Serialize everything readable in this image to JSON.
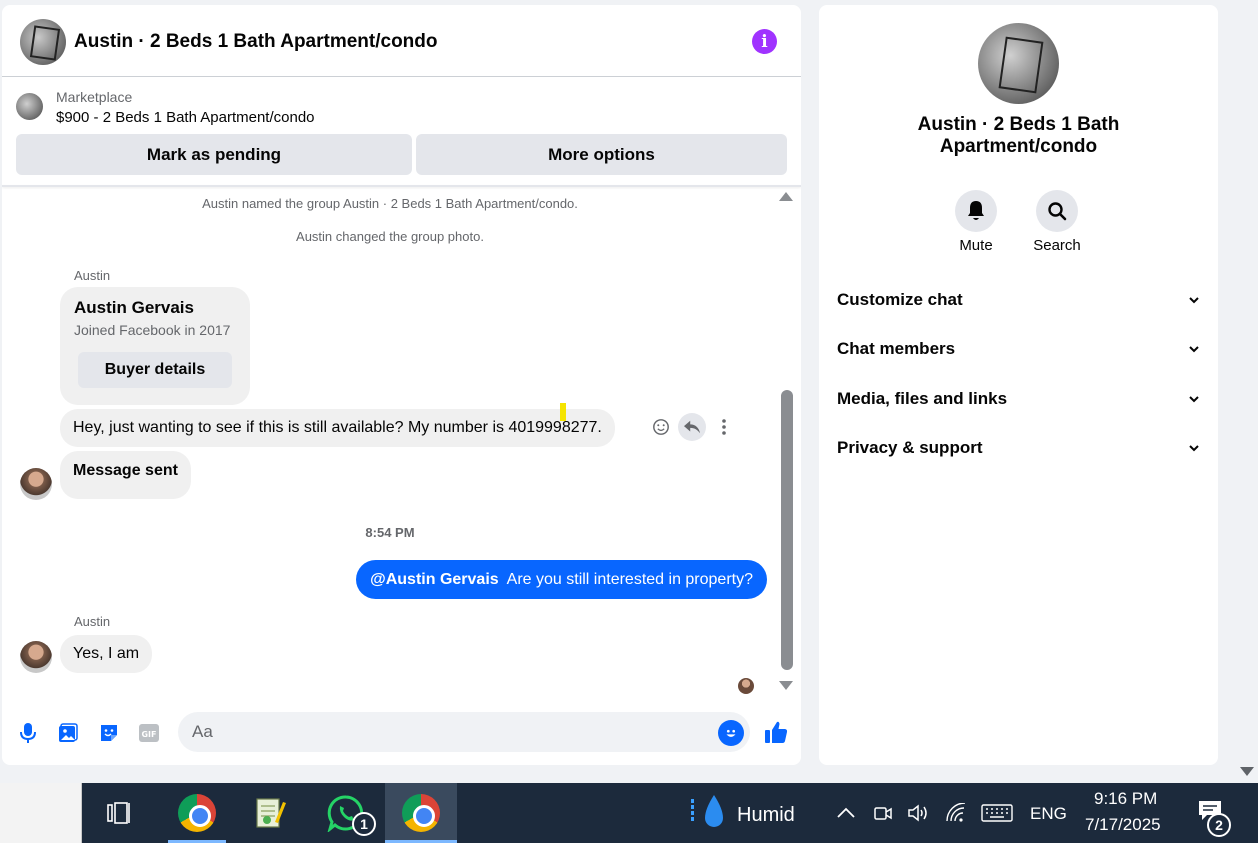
{
  "chat": {
    "title": "Austin · 2 Beds 1 Bath Apartment/condo",
    "marketplace": {
      "label": "Marketplace",
      "listing": "$900 - 2 Beds 1 Bath Apartment/condo",
      "mark_pending": "Mark as pending",
      "more_options": "More options"
    },
    "system_messages": [
      "Austin named the group Austin · 2 Beds 1 Bath Apartment/condo.",
      "Austin changed the group photo."
    ],
    "sender_1": "Austin",
    "card": {
      "name": "Austin Gervais",
      "subtitle": "Joined Facebook in 2017",
      "button": "Buyer details"
    },
    "message_1": "Hey, just wanting to see if this is still available? My number is 4019998277.",
    "message_sent": "Message sent",
    "timestamp": "8:54 PM",
    "outgoing": {
      "mention": "@Austin Gervais",
      "text": "Are you still interested in property?"
    },
    "sender_2": "Austin",
    "reply": "Yes, I am",
    "composer_placeholder": "Aa"
  },
  "info": {
    "title": "Austin · 2 Beds 1 Bath Apartment/condo",
    "mute_label": "Mute",
    "search_label": "Search",
    "sections": [
      "Customize chat",
      "Chat members",
      "Media, files and links",
      "Privacy & support"
    ]
  },
  "taskbar": {
    "whatsapp_badge": "1",
    "weather": "Humid",
    "language": "ENG",
    "time": "9:16 PM",
    "date": "7/17/2025",
    "notifications": "2"
  },
  "colors": {
    "accent": "#0866ff",
    "info_icon": "#a033ff",
    "taskbar": "#1c2a3c"
  }
}
